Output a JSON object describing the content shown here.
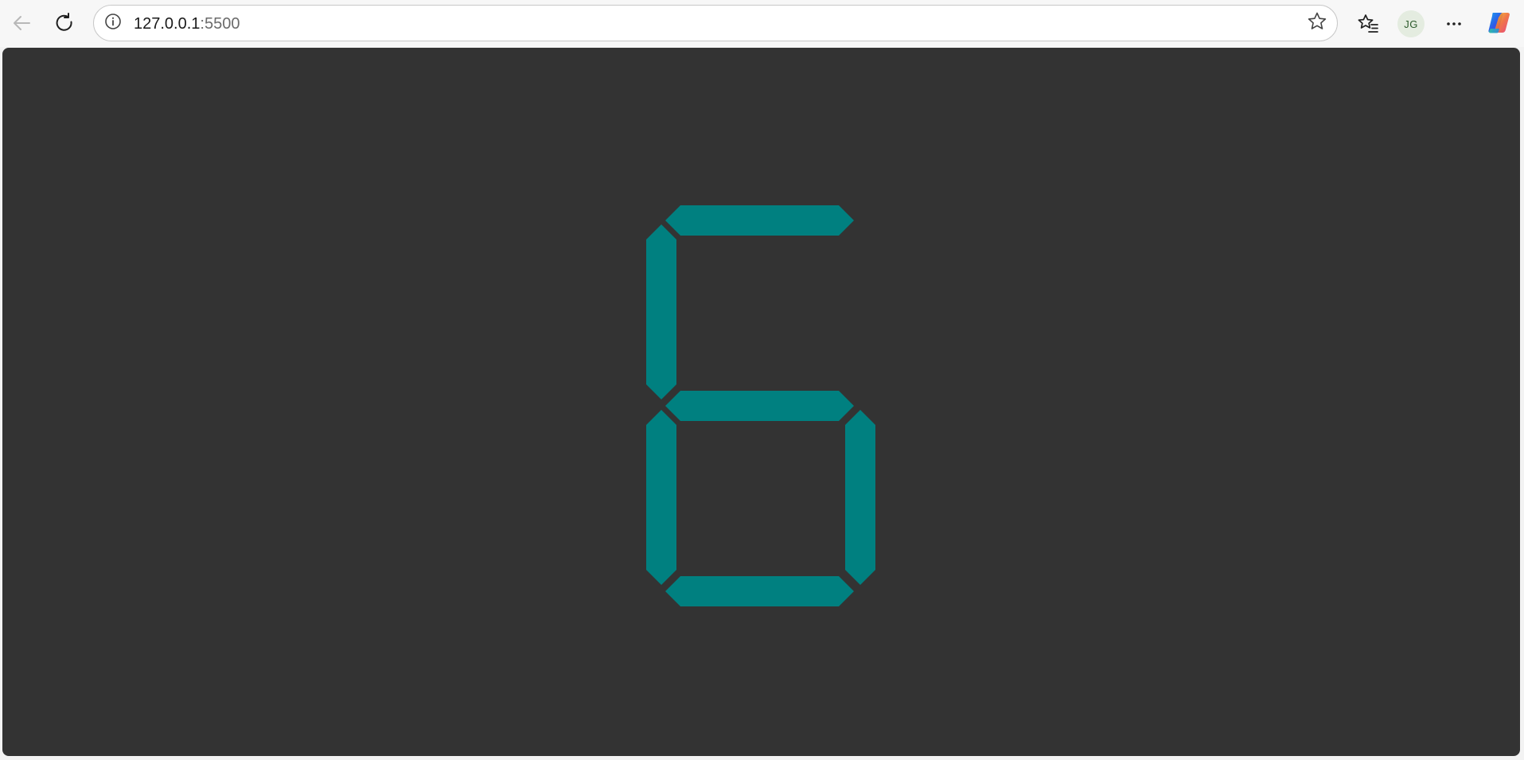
{
  "browser": {
    "address_bar": {
      "host": "127.0.0.1",
      "port": ":5500"
    },
    "profile_initials": "JG",
    "icons": {
      "back": "arrow-left-icon",
      "refresh": "refresh-icon",
      "site_info": "info-circle-icon",
      "favorite": "star-outline-icon",
      "favorites_list": "favorites-list-icon",
      "more": "more-horizontal-icon",
      "copilot": "copilot-logo-icon"
    }
  },
  "page": {
    "background_color": "#333333",
    "display": {
      "digit": "6",
      "segment_on_color": "#008080",
      "segments": {
        "a": true,
        "b": false,
        "c": true,
        "d": true,
        "e": true,
        "f": true,
        "g": true
      }
    }
  }
}
